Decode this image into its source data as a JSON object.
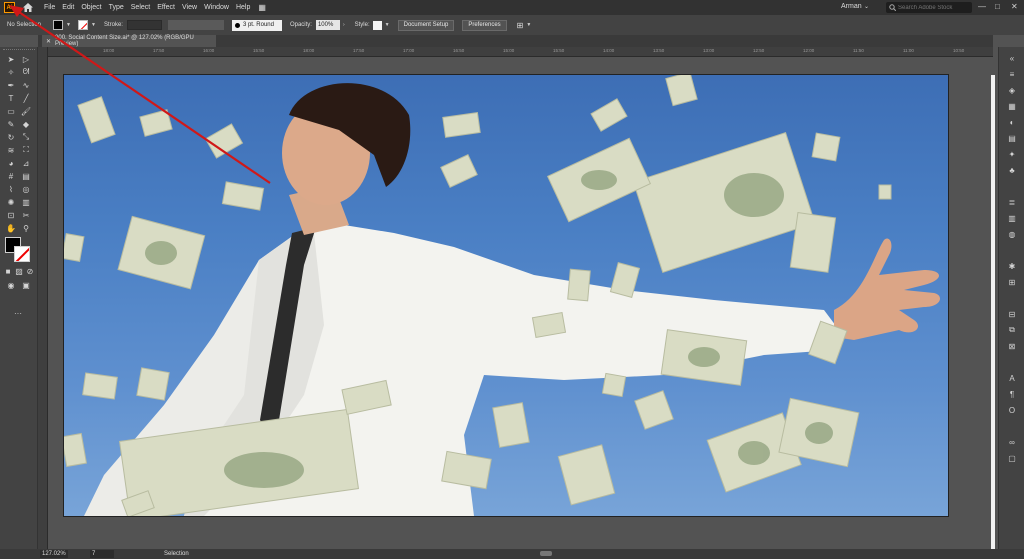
{
  "menu": {
    "logo": "Ai",
    "items": [
      "File",
      "Edit",
      "Object",
      "Type",
      "Select",
      "Effect",
      "View",
      "Window",
      "Help"
    ],
    "user": "Arman",
    "search_placeholder": "Search Adobe Stock"
  },
  "control": {
    "selection": "No Selection",
    "stroke_label": "Stroke:",
    "brush": "3 pt. Round",
    "opacity_label": "Opacity:",
    "opacity_value": "100%",
    "style_label": "Style:",
    "document_setup": "Document Setup",
    "preferences": "Preferences"
  },
  "tab": {
    "title": "000. Social Content Size.ai* @ 127.02% (RGB/GPU Preview)"
  },
  "ruler": {
    "ticks": [
      "18:00",
      "17:50",
      "16:00",
      "15:50",
      "18:00",
      "17:50",
      "17:00",
      "16:50",
      "15:00",
      "15:50",
      "14:00",
      "13:50",
      "13:00",
      "12:50",
      "12:00",
      "11:50",
      "11:00",
      "10:50"
    ]
  },
  "status": {
    "zoom": "127.02%",
    "page": "7",
    "text": "Selection"
  },
  "colors": {
    "annotation_arrow": "#d01818",
    "accent_logo": "#ff9a00"
  },
  "icons": {
    "tools": [
      "selection-tool-icon",
      "direct-selection-tool-icon",
      "magic-wand-icon",
      "lasso-icon",
      "pen-tool-icon",
      "curvature-icon",
      "type-tool-icon",
      "line-tool-icon",
      "rectangle-tool-icon",
      "paintbrush-icon",
      "pencil-icon",
      "eraser-icon",
      "rotate-icon",
      "scale-icon",
      "warp-icon",
      "free-transform-icon",
      "shape-builder-icon",
      "perspective-icon",
      "mesh-icon",
      "gradient-icon",
      "eyedropper-icon",
      "blend-icon",
      "symbol-sprayer-icon",
      "graph-icon",
      "artboard-icon",
      "slice-icon",
      "hand-icon",
      "zoom-icon"
    ]
  }
}
